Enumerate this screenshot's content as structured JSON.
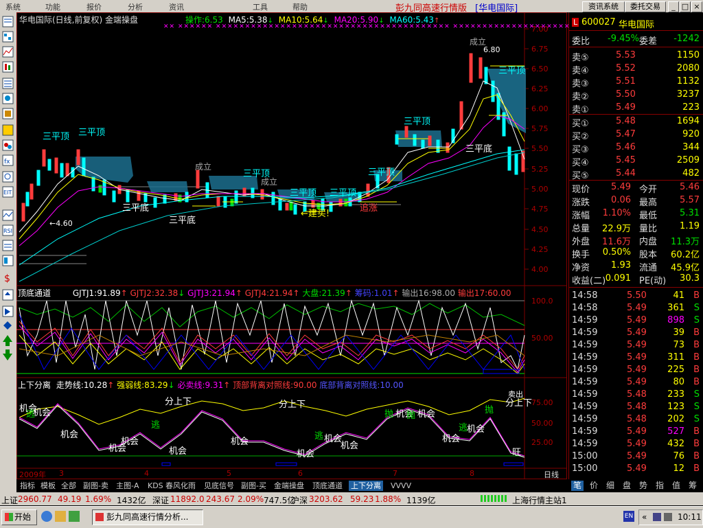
{
  "menu": {
    "items": [
      "系统",
      "功能",
      "报价",
      "分析",
      "资讯",
      "工具",
      "帮助"
    ],
    "title": "彭九同高速行情版",
    "stock_tag": "[华电国际]",
    "right_buttons": [
      "资讯系统",
      "委托交易"
    ]
  },
  "chart": {
    "header": "华电国际(日线,前复权) 金端操盘",
    "op": "操作:6.53",
    "ma5": "MA5:5.38",
    "ma10": "MA10:5.64",
    "ma20": "MA20:5.90",
    "ma60": "MA60:5.43",
    "price_axis": [
      "7.00",
      "6.75",
      "6.50",
      "6.25",
      "6.00",
      "5.75",
      "5.50",
      "5.25",
      "5.00",
      "4.75",
      "4.50",
      "4.25",
      "4.00"
    ],
    "annotations": {
      "pd1": "三平顶",
      "pd2": "三平顶",
      "pd3": "三平顶",
      "pd4": "三平顶",
      "pd5": "三平顶",
      "pd6": "三平顶",
      "pd7": "三平顶",
      "pd8": "三平顶",
      "pb1": "三平底",
      "pb2": "三平底",
      "pb3": "三平底",
      "cl1": "成立",
      "cl2": "成立",
      "cl3": "成立",
      "low": "4.60",
      "high": "6.80",
      "buy": "←建买!",
      "chase": "追涨"
    }
  },
  "ind1": {
    "name": "顶底通道",
    "g1": "GJTJ1:91.89",
    "g2": "GJTJ2:32.38",
    "g3": "GJTJ3:21.94",
    "g4": "GJTJ4:21.94",
    "dapan": "大盘:21.39",
    "chou": "筹码:1.01",
    "out1": "输出16:98.00",
    "out2": "输出17:60.00",
    "axis": [
      "100.0",
      "50.00"
    ]
  },
  "ind2": {
    "name": "上下分离",
    "trend": "走势线:10.28",
    "strong": "强弱线:83.29",
    "must": "必卖线:9.31",
    "top": "顶部背离对照线:90.00",
    "bottom": "底部背离对照线:10.00",
    "axis": [
      "75.00",
      "50.00",
      "25.00"
    ],
    "labels": {
      "jh1": "机会",
      "jh2": "机会",
      "jh3": "机会",
      "jh4": "机会",
      "jh5": "机会",
      "jh6": "机会",
      "jh7": "机会",
      "jh8": "机会",
      "jh9": "机会",
      "jh10": "机会",
      "jh11": "机会",
      "jh12": "机会",
      "tao1": "逃",
      "tao2": "逃",
      "tao3": "逃",
      "tao4": "逃",
      "tao5": "逃",
      "pao1": "抛",
      "pao2": "抛",
      "pao3": "抛",
      "fsx1": "分上下",
      "fsx2": "分上下",
      "fsx3": "分上下",
      "wang": "旺",
      "sell": "卖出"
    }
  },
  "date_axis": [
    "2009年",
    "3",
    "4",
    "5",
    "6",
    "7",
    "8"
  ],
  "period": "日线",
  "tabs": [
    "指标",
    "模板",
    "全部",
    "副图-卖",
    "主图-A",
    "KDS",
    "春风化雨",
    "见底信号",
    "副图-买",
    "金端操盘",
    "顶底通道",
    "上下分离",
    "VVVV"
  ],
  "quote": {
    "code": "600027",
    "name": "华电国际",
    "weibi_label": "委比",
    "weibi": "-9.45%",
    "weicha_label": "委差",
    "weicha": "-1242",
    "asks": [
      {
        "label": "卖⑤",
        "price": "5.53",
        "vol": "1150"
      },
      {
        "label": "卖④",
        "price": "5.52",
        "vol": "2080"
      },
      {
        "label": "卖③",
        "price": "5.51",
        "vol": "1132"
      },
      {
        "label": "卖②",
        "price": "5.50",
        "vol": "3237"
      },
      {
        "label": "卖①",
        "price": "5.49",
        "vol": "223"
      }
    ],
    "bids": [
      {
        "label": "买①",
        "price": "5.48",
        "vol": "1694"
      },
      {
        "label": "买②",
        "price": "5.47",
        "vol": "920"
      },
      {
        "label": "买③",
        "price": "5.46",
        "vol": "344"
      },
      {
        "label": "买④",
        "price": "5.45",
        "vol": "2509"
      },
      {
        "label": "买⑤",
        "price": "5.44",
        "vol": "482"
      }
    ],
    "stats": [
      {
        "l1": "现价",
        "v1": "5.49",
        "l2": "今开",
        "v2": "5.46"
      },
      {
        "l1": "涨跌",
        "v1": "0.06",
        "l2": "最高",
        "v2": "5.57"
      },
      {
        "l1": "涨幅",
        "v1": "1.10%",
        "l2": "最低",
        "v2": "5.31"
      },
      {
        "l1": "总量",
        "v1": "22.9万",
        "l2": "量比",
        "v2": "1.19"
      },
      {
        "l1": "外盘",
        "v1": "11.6万",
        "l2": "内盘",
        "v2": "11.3万"
      },
      {
        "l1": "换手",
        "v1": "0.50%",
        "l2": "股本",
        "v2": "60.2亿"
      },
      {
        "l1": "净资",
        "v1": "1.93",
        "l2": "流通",
        "v2": "45.9亿"
      },
      {
        "l1": "收益(二)",
        "v1": "0.091",
        "l2": "PE(动)",
        "v2": "30.3"
      }
    ],
    "ticks": [
      {
        "t": "14:58",
        "p": "5.50",
        "v": "41",
        "d": "B"
      },
      {
        "t": "14:58",
        "p": "5.49",
        "v": "361",
        "d": "S"
      },
      {
        "t": "14:59",
        "p": "5.49",
        "v": "898",
        "d": "S"
      },
      {
        "t": "14:59",
        "p": "5.49",
        "v": "39",
        "d": "B"
      },
      {
        "t": "14:59",
        "p": "5.49",
        "v": "73",
        "d": "B"
      },
      {
        "t": "14:59",
        "p": "5.49",
        "v": "311",
        "d": "B"
      },
      {
        "t": "14:59",
        "p": "5.49",
        "v": "225",
        "d": "B"
      },
      {
        "t": "14:59",
        "p": "5.49",
        "v": "80",
        "d": "B"
      },
      {
        "t": "14:59",
        "p": "5.48",
        "v": "233",
        "d": "S"
      },
      {
        "t": "14:59",
        "p": "5.48",
        "v": "123",
        "d": "S"
      },
      {
        "t": "14:59",
        "p": "5.48",
        "v": "202",
        "d": "S"
      },
      {
        "t": "14:59",
        "p": "5.49",
        "v": "527",
        "d": "B"
      },
      {
        "t": "14:59",
        "p": "5.49",
        "v": "432",
        "d": "B"
      },
      {
        "t": "15:00",
        "p": "5.49",
        "v": "76",
        "d": "B"
      },
      {
        "t": "15:00",
        "p": "5.49",
        "v": "12",
        "d": "B"
      }
    ],
    "tabs": [
      "笔",
      "价",
      "细",
      "盘",
      "势",
      "指",
      "值",
      "筹"
    ]
  },
  "status": {
    "sh_label": "上证",
    "sh": "2960.77",
    "sh_chg": "49.19",
    "sh_pct": "1.69%",
    "sh_amt": "1432亿",
    "sz_label": "深证",
    "sz": "11892.0",
    "sz_chg": "243.67",
    "sz_pct": "2.09%",
    "sz_amt": "747.5亿",
    "hs_label": "沪深",
    "hs": "3203.62",
    "hs_chg": "59.23",
    "hs_pct": "1.88%",
    "hs_amt": "1139亿",
    "server": "上海行情主站1"
  },
  "taskbar": {
    "start": "开始",
    "task": "彭九同高速行情分析...",
    "lang": "EN",
    "time": "10:11"
  },
  "colors": {
    "up": "#ff3c3c",
    "down": "#00e000",
    "bg": "#000000",
    "ma5": "#ffffff",
    "ma10": "#ffff00",
    "ma20": "#ff00ff",
    "ma60": "#00ffff"
  }
}
